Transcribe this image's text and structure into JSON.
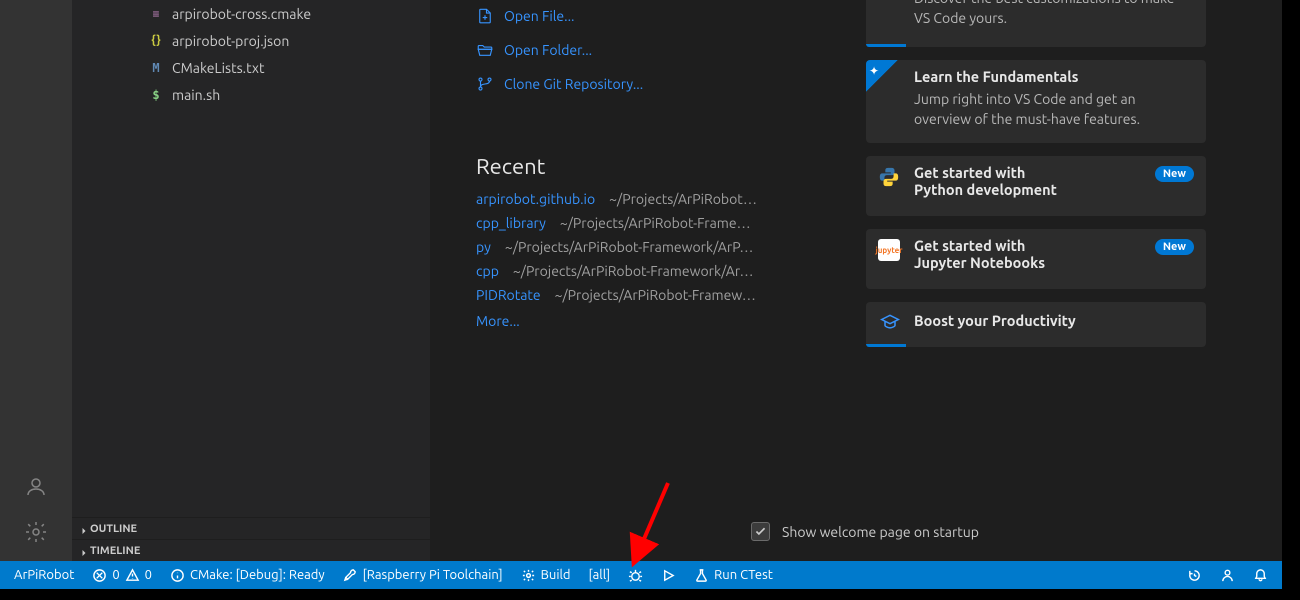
{
  "explorer": {
    "files": [
      {
        "icon": "cmake",
        "glyph": "≡",
        "name": "arpirobot-cross.cmake"
      },
      {
        "icon": "json",
        "glyph": "{}",
        "name": "arpirobot-proj.json"
      },
      {
        "icon": "m",
        "glyph": "M",
        "name": "CMakeLists.txt"
      },
      {
        "icon": "sh",
        "glyph": "$",
        "name": "main.sh"
      }
    ],
    "sections": {
      "outline": "OUTLINE",
      "timeline": "TIMELINE"
    }
  },
  "welcome": {
    "start": {
      "open_file": "Open File...",
      "open_folder": "Open Folder...",
      "clone_repo": "Clone Git Repository..."
    },
    "recent_header": "Recent",
    "recent": [
      {
        "name": "arpirobot.github.io",
        "path": "~/Projects/ArPiRobot…"
      },
      {
        "name": "cpp_library",
        "path": "~/Projects/ArPiRobot-Frame…"
      },
      {
        "name": "py",
        "path": "~/Projects/ArPiRobot-Framework/ArP…"
      },
      {
        "name": "cpp",
        "path": "~/Projects/ArPiRobot-Framework/Ar…"
      },
      {
        "name": "PIDRotate",
        "path": "~/Projects/ArPiRobot-Framew…"
      }
    ],
    "more": "More...",
    "walkthroughs": {
      "customize": {
        "desc": "Discover the best customizations to make VS Code yours."
      },
      "fundamentals": {
        "title": "Learn the Fundamentals",
        "desc": "Jump right into VS Code and get an overview of the must-have features."
      },
      "python": {
        "title_line1": "Get started with",
        "title_line2": "Python development",
        "badge": "New"
      },
      "jupyter": {
        "title_line1": "Get started with",
        "title_line2": "Jupyter Notebooks",
        "badge": "New"
      },
      "productivity": {
        "title": "Boost your Productivity"
      }
    },
    "checkbox_label": "Show welcome page on startup",
    "checkbox_checked": true
  },
  "statusbar": {
    "project": "ArPiRobot",
    "errors": "0",
    "warnings": "0",
    "cmake_status": "CMake: [Debug]: Ready",
    "toolchain": "[Raspberry Pi Toolchain]",
    "build": "Build",
    "target": "[all]",
    "ctest": "Run CTest"
  },
  "annotation": {
    "arrow_color": "#ff0000"
  }
}
